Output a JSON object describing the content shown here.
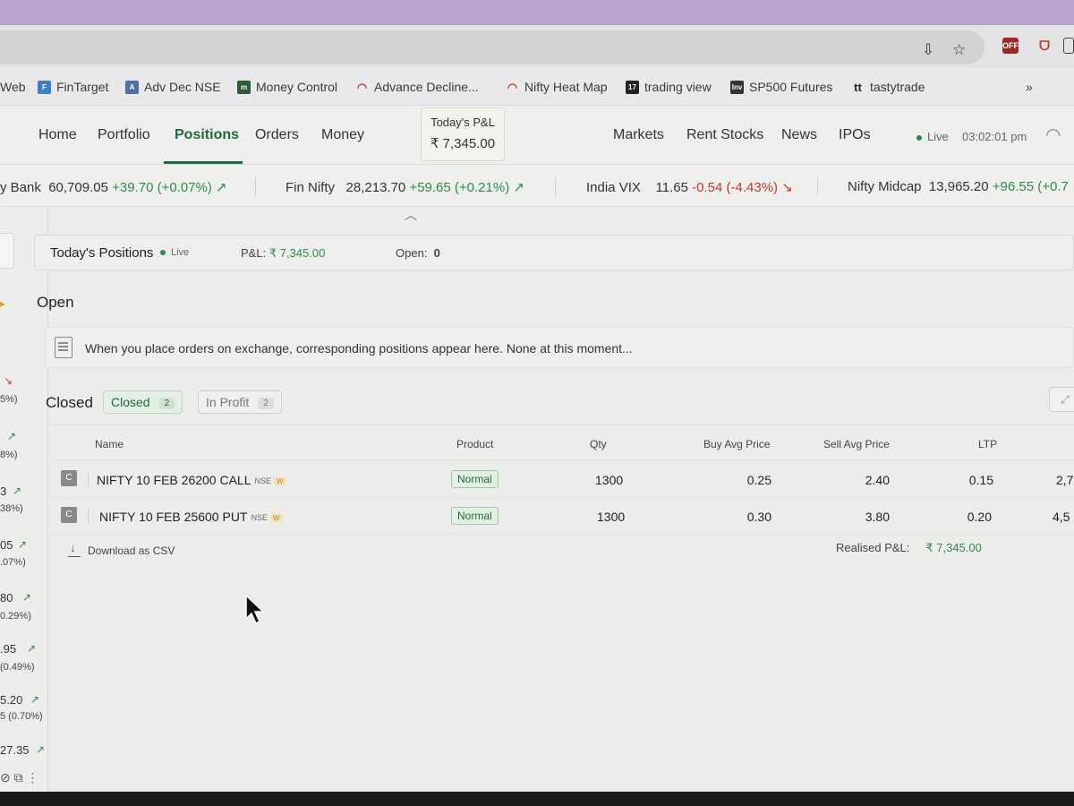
{
  "colors": {
    "accent": "#1f6b3d",
    "profit": "#2f8a4c",
    "loss": "#c0392b"
  },
  "bookmarks": [
    {
      "label": "Web",
      "icon": "web-icon"
    },
    {
      "label": "FinTarget",
      "icon": "fintarget-icon"
    },
    {
      "label": "Adv Dec NSE",
      "icon": "advdec-icon"
    },
    {
      "label": "Money Control",
      "icon": "moneycontrol-icon"
    },
    {
      "label": "Advance Decline...",
      "icon": "gauge-icon"
    },
    {
      "label": "Nifty Heat Map",
      "icon": "gauge-icon"
    },
    {
      "label": "trading view",
      "icon": "tradingview-icon"
    },
    {
      "label": "SP500 Futures",
      "icon": "investing-icon"
    },
    {
      "label": "tastytrade",
      "icon": "tastytrade-icon"
    }
  ],
  "bookmarks_more": "»",
  "nav": {
    "home": "Home",
    "portfolio": "Portfolio",
    "positions": "Positions",
    "orders": "Orders",
    "money": "Money",
    "pnl_label": "Today's P&L",
    "pnl_value": "₹ 7,345.00",
    "markets": "Markets",
    "rent_stocks": "Rent Stocks",
    "news": "News",
    "ipos": "IPOs",
    "live": "Live",
    "time": "03:02:01 pm"
  },
  "ticker": [
    {
      "name": "y Bank",
      "value": "60,709.05",
      "change": "+39.70 (+0.07%)",
      "dir": "up"
    },
    {
      "name": "Fin Nifty",
      "value": "28,213.70",
      "change": "+59.65 (+0.21%)",
      "dir": "up"
    },
    {
      "name": "India VIX",
      "value": "11.65",
      "change": "-0.54 (-4.43%)",
      "dir": "down"
    },
    {
      "name": "Nifty Midcap",
      "value": "13,965.20",
      "change": "+96.55 (+0.7",
      "dir": "up"
    }
  ],
  "left_panel": [
    {
      "num": "",
      "pct": "5%)",
      "dir": "down"
    },
    {
      "num": "",
      "pct": "8%)",
      "dir": "up"
    },
    {
      "num": "3",
      "pct": "38%)",
      "dir": "up"
    },
    {
      "num": "05",
      "pct": ".07%)",
      "dir": "up"
    },
    {
      "num": "80",
      "pct": "0.29%)",
      "dir": "up"
    },
    {
      "num": ".95",
      "pct": "(0.49%)",
      "dir": "up"
    },
    {
      "num": "5.20",
      "pct": "5 (0.70%)",
      "dir": "up"
    },
    {
      "num": "27.35",
      "pct": "",
      "dir": "up"
    }
  ],
  "positions_header": {
    "title": "Today's Positions",
    "live": "Live",
    "pnl_label": "P&L:",
    "pnl_value": "₹ 7,345.00",
    "open_label": "Open:",
    "open_value": "0"
  },
  "open_section": {
    "title": "Open",
    "empty_message": "When you place orders on exchange, corresponding positions appear here. None at this moment..."
  },
  "closed_section": {
    "title": "Closed",
    "tabs": [
      {
        "label": "Closed",
        "count": "2"
      },
      {
        "label": "In Profit",
        "count": "2"
      }
    ]
  },
  "table": {
    "headers": [
      "Name",
      "Product",
      "Qty",
      "Buy Avg Price",
      "Sell Avg Price",
      "LTP"
    ],
    "rows": [
      {
        "badge": "C",
        "name": "NIFTY 10 FEB 26200 CALL",
        "exchange": "NSE",
        "weekly": "W",
        "product": "Normal",
        "qty": "1300",
        "buy_avg": "0.25",
        "sell_avg": "2.40",
        "ltp": "0.15",
        "extra": "2,7"
      },
      {
        "badge": "C",
        "name": "NIFTY 10 FEB 25600 PUT",
        "exchange": "NSE",
        "weekly": "W",
        "product": "Normal",
        "qty": "1300",
        "buy_avg": "0.30",
        "sell_avg": "3.80",
        "ltp": "0.20",
        "extra": "4,5"
      }
    ]
  },
  "footer": {
    "download_label": "Download as CSV",
    "realised_label": "Realised P&L:",
    "realised_value": "₹ 7,345.00"
  }
}
